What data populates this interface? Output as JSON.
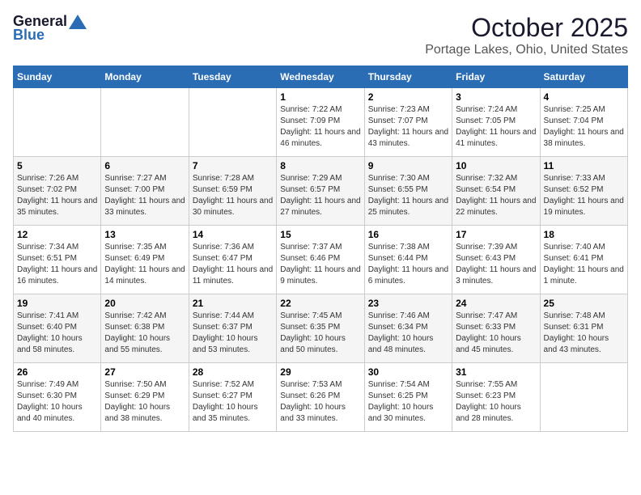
{
  "header": {
    "logo_general": "General",
    "logo_blue": "Blue",
    "month": "October 2025",
    "location": "Portage Lakes, Ohio, United States"
  },
  "days_of_week": [
    "Sunday",
    "Monday",
    "Tuesday",
    "Wednesday",
    "Thursday",
    "Friday",
    "Saturday"
  ],
  "weeks": [
    [
      {
        "day": "",
        "info": ""
      },
      {
        "day": "",
        "info": ""
      },
      {
        "day": "",
        "info": ""
      },
      {
        "day": "1",
        "info": "Sunrise: 7:22 AM\nSunset: 7:09 PM\nDaylight: 11 hours and 46 minutes."
      },
      {
        "day": "2",
        "info": "Sunrise: 7:23 AM\nSunset: 7:07 PM\nDaylight: 11 hours and 43 minutes."
      },
      {
        "day": "3",
        "info": "Sunrise: 7:24 AM\nSunset: 7:05 PM\nDaylight: 11 hours and 41 minutes."
      },
      {
        "day": "4",
        "info": "Sunrise: 7:25 AM\nSunset: 7:04 PM\nDaylight: 11 hours and 38 minutes."
      }
    ],
    [
      {
        "day": "5",
        "info": "Sunrise: 7:26 AM\nSunset: 7:02 PM\nDaylight: 11 hours and 35 minutes."
      },
      {
        "day": "6",
        "info": "Sunrise: 7:27 AM\nSunset: 7:00 PM\nDaylight: 11 hours and 33 minutes."
      },
      {
        "day": "7",
        "info": "Sunrise: 7:28 AM\nSunset: 6:59 PM\nDaylight: 11 hours and 30 minutes."
      },
      {
        "day": "8",
        "info": "Sunrise: 7:29 AM\nSunset: 6:57 PM\nDaylight: 11 hours and 27 minutes."
      },
      {
        "day": "9",
        "info": "Sunrise: 7:30 AM\nSunset: 6:55 PM\nDaylight: 11 hours and 25 minutes."
      },
      {
        "day": "10",
        "info": "Sunrise: 7:32 AM\nSunset: 6:54 PM\nDaylight: 11 hours and 22 minutes."
      },
      {
        "day": "11",
        "info": "Sunrise: 7:33 AM\nSunset: 6:52 PM\nDaylight: 11 hours and 19 minutes."
      }
    ],
    [
      {
        "day": "12",
        "info": "Sunrise: 7:34 AM\nSunset: 6:51 PM\nDaylight: 11 hours and 16 minutes."
      },
      {
        "day": "13",
        "info": "Sunrise: 7:35 AM\nSunset: 6:49 PM\nDaylight: 11 hours and 14 minutes."
      },
      {
        "day": "14",
        "info": "Sunrise: 7:36 AM\nSunset: 6:47 PM\nDaylight: 11 hours and 11 minutes."
      },
      {
        "day": "15",
        "info": "Sunrise: 7:37 AM\nSunset: 6:46 PM\nDaylight: 11 hours and 9 minutes."
      },
      {
        "day": "16",
        "info": "Sunrise: 7:38 AM\nSunset: 6:44 PM\nDaylight: 11 hours and 6 minutes."
      },
      {
        "day": "17",
        "info": "Sunrise: 7:39 AM\nSunset: 6:43 PM\nDaylight: 11 hours and 3 minutes."
      },
      {
        "day": "18",
        "info": "Sunrise: 7:40 AM\nSunset: 6:41 PM\nDaylight: 11 hours and 1 minute."
      }
    ],
    [
      {
        "day": "19",
        "info": "Sunrise: 7:41 AM\nSunset: 6:40 PM\nDaylight: 10 hours and 58 minutes."
      },
      {
        "day": "20",
        "info": "Sunrise: 7:42 AM\nSunset: 6:38 PM\nDaylight: 10 hours and 55 minutes."
      },
      {
        "day": "21",
        "info": "Sunrise: 7:44 AM\nSunset: 6:37 PM\nDaylight: 10 hours and 53 minutes."
      },
      {
        "day": "22",
        "info": "Sunrise: 7:45 AM\nSunset: 6:35 PM\nDaylight: 10 hours and 50 minutes."
      },
      {
        "day": "23",
        "info": "Sunrise: 7:46 AM\nSunset: 6:34 PM\nDaylight: 10 hours and 48 minutes."
      },
      {
        "day": "24",
        "info": "Sunrise: 7:47 AM\nSunset: 6:33 PM\nDaylight: 10 hours and 45 minutes."
      },
      {
        "day": "25",
        "info": "Sunrise: 7:48 AM\nSunset: 6:31 PM\nDaylight: 10 hours and 43 minutes."
      }
    ],
    [
      {
        "day": "26",
        "info": "Sunrise: 7:49 AM\nSunset: 6:30 PM\nDaylight: 10 hours and 40 minutes."
      },
      {
        "day": "27",
        "info": "Sunrise: 7:50 AM\nSunset: 6:29 PM\nDaylight: 10 hours and 38 minutes."
      },
      {
        "day": "28",
        "info": "Sunrise: 7:52 AM\nSunset: 6:27 PM\nDaylight: 10 hours and 35 minutes."
      },
      {
        "day": "29",
        "info": "Sunrise: 7:53 AM\nSunset: 6:26 PM\nDaylight: 10 hours and 33 minutes."
      },
      {
        "day": "30",
        "info": "Sunrise: 7:54 AM\nSunset: 6:25 PM\nDaylight: 10 hours and 30 minutes."
      },
      {
        "day": "31",
        "info": "Sunrise: 7:55 AM\nSunset: 6:23 PM\nDaylight: 10 hours and 28 minutes."
      },
      {
        "day": "",
        "info": ""
      }
    ]
  ]
}
